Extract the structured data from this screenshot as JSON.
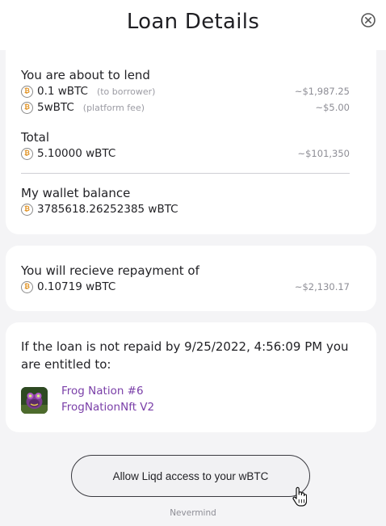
{
  "modal": {
    "title": "Loan Details"
  },
  "lend": {
    "heading": "You are about to lend",
    "items": [
      {
        "amount": "0.1 wBTC",
        "note": "(to borrower)",
        "usd": "~$1,987.25"
      },
      {
        "amount": "5wBTC",
        "note": "(platform fee)",
        "usd": "~$5.00"
      }
    ]
  },
  "total": {
    "heading": "Total",
    "amount": "5.10000 wBTC",
    "usd": "~$101,350"
  },
  "wallet": {
    "heading": "My wallet balance",
    "amount": "3785618.26252385 wBTC"
  },
  "repayment": {
    "heading": "You will recieve repayment of",
    "amount": "0.10719 wBTC",
    "usd": "~$2,130.17"
  },
  "collateral": {
    "text": "If the loan is not repaid by 9/25/2022, 4:56:09 PM you are entitled to:",
    "nft_name": "Frog Nation #6",
    "nft_collection": "FrogNationNft V2"
  },
  "actions": {
    "allow_label": "Allow Liqd access to your wBTC",
    "nevermind_label": "Nevermind"
  },
  "icons": {
    "coin_glyph": "₿",
    "coin_color": "#e0901e",
    "link_color": "#7a3fa8"
  }
}
